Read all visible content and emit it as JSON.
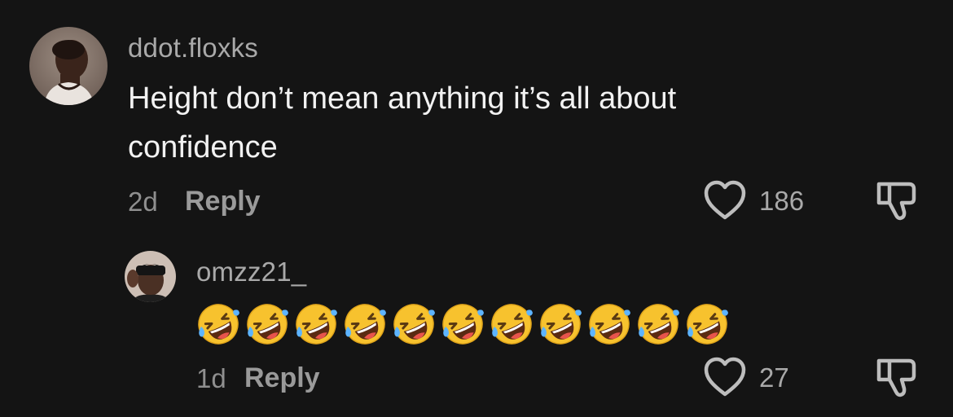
{
  "comments": [
    {
      "username": "ddot.floxks",
      "text": "Height don’t mean anything it’s all about confidence",
      "time": "2d",
      "reply_label": "Reply",
      "likes": "186"
    }
  ],
  "replies": [
    {
      "username": "omzz21_",
      "emoji_count": 11,
      "emoji_name": "rolling-on-the-floor-laughing-emoji",
      "time": "1d",
      "reply_label": "Reply",
      "likes": "27"
    }
  ],
  "colors": {
    "background": "#141414",
    "text": "#f2f2f2",
    "secondary_text": "#a9a9a9",
    "icon": "#bdbdbd"
  },
  "icons": {
    "like": "heart-outline-icon",
    "dislike": "thumbs-down-outline-icon"
  }
}
